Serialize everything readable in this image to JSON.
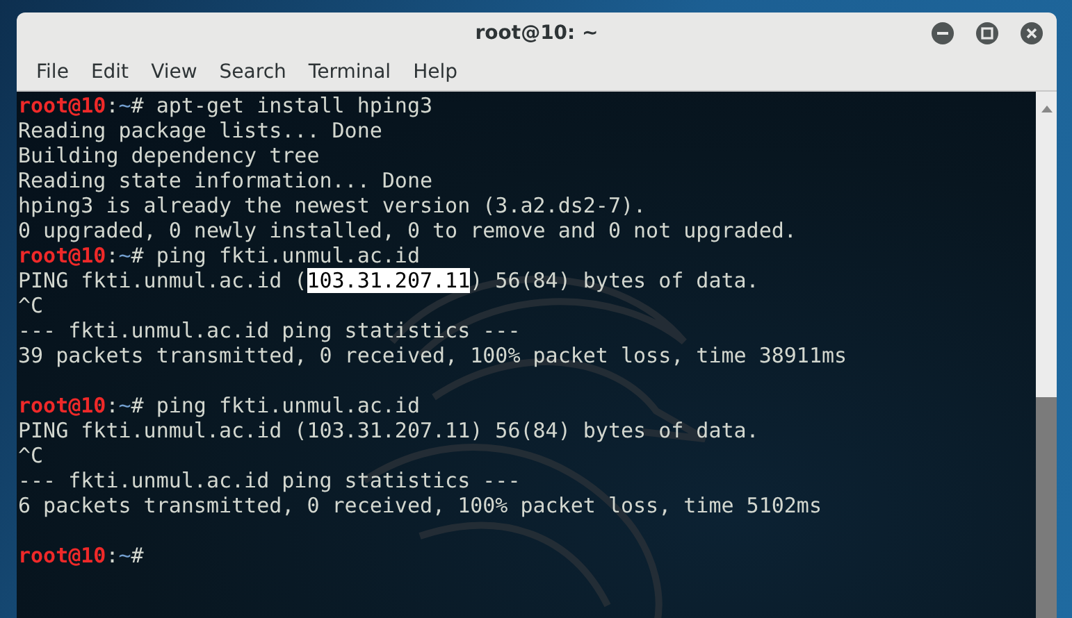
{
  "window": {
    "title": "root@10: ~"
  },
  "menu": [
    {
      "label": "File"
    },
    {
      "label": "Edit"
    },
    {
      "label": "View"
    },
    {
      "label": "Search"
    },
    {
      "label": "Terminal"
    },
    {
      "label": "Help"
    }
  ],
  "terminal": {
    "lines": [
      {
        "kind": "prompt",
        "user": "root@10",
        "path": ":~#",
        "command": " apt-get install hping3"
      },
      {
        "kind": "output",
        "segments": [
          {
            "text": "Reading package lists... Done",
            "selected": false
          }
        ]
      },
      {
        "kind": "output",
        "segments": [
          {
            "text": "Building dependency tree",
            "selected": false
          }
        ]
      },
      {
        "kind": "output",
        "segments": [
          {
            "text": "Reading state information... Done",
            "selected": false
          }
        ]
      },
      {
        "kind": "output",
        "segments": [
          {
            "text": "hping3 is already the newest version (3.a2.ds2-7).",
            "selected": false
          }
        ]
      },
      {
        "kind": "output",
        "segments": [
          {
            "text": "0 upgraded, 0 newly installed, 0 to remove and 0 not upgraded.",
            "selected": false
          }
        ]
      },
      {
        "kind": "prompt",
        "user": "root@10",
        "path": ":~#",
        "command": " ping fkti.unmul.ac.id"
      },
      {
        "kind": "output",
        "segments": [
          {
            "text": "PING fkti.unmul.ac.id (",
            "selected": false
          },
          {
            "text": "103.31.207.11",
            "selected": true
          },
          {
            "text": ") 56(84) bytes of data.",
            "selected": false
          }
        ]
      },
      {
        "kind": "output",
        "segments": [
          {
            "text": "^C",
            "selected": false
          }
        ]
      },
      {
        "kind": "output",
        "segments": [
          {
            "text": "--- fkti.unmul.ac.id ping statistics ---",
            "selected": false
          }
        ]
      },
      {
        "kind": "output",
        "segments": [
          {
            "text": "39 packets transmitted, 0 received, 100% packet loss, time 38911ms",
            "selected": false
          }
        ]
      },
      {
        "kind": "blank"
      },
      {
        "kind": "prompt",
        "user": "root@10",
        "path": ":~#",
        "command": " ping fkti.unmul.ac.id"
      },
      {
        "kind": "output",
        "segments": [
          {
            "text": "PING fkti.unmul.ac.id (103.31.207.11) 56(84) bytes of data.",
            "selected": false
          }
        ]
      },
      {
        "kind": "output",
        "segments": [
          {
            "text": "^C",
            "selected": false
          }
        ]
      },
      {
        "kind": "output",
        "segments": [
          {
            "text": "--- fkti.unmul.ac.id ping statistics ---",
            "selected": false
          }
        ]
      },
      {
        "kind": "output",
        "segments": [
          {
            "text": "6 packets transmitted, 0 received, 100% packet loss, time 5102ms",
            "selected": false
          }
        ]
      },
      {
        "kind": "blank"
      },
      {
        "kind": "prompt",
        "user": "root@10",
        "path": ":~#"
      }
    ]
  }
}
